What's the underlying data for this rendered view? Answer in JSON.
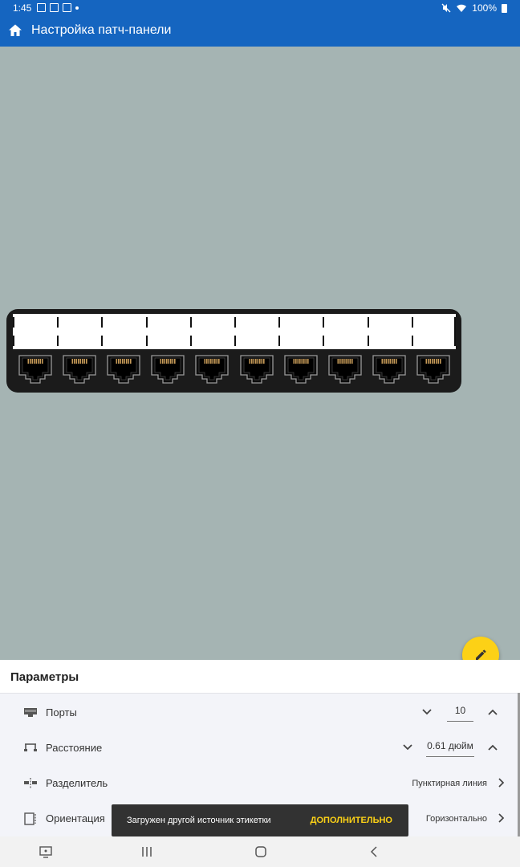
{
  "status_bar": {
    "time": "1:45",
    "battery": "100%",
    "icons": [
      "image-icon",
      "gmail-icon",
      "gallery-icon",
      "dot-icon",
      "mute-icon",
      "wifi-icon",
      "battery-icon"
    ]
  },
  "app_bar": {
    "title": "Настройка патч-панели",
    "icon": "home-icon"
  },
  "panel_preview": {
    "port_count": 10,
    "label_count": 10,
    "colors": {
      "panel": "#1b1b1b",
      "label": "#ffffff",
      "contacts": "#c69a58"
    }
  },
  "fab": {
    "icon": "pencil-icon",
    "color": "#fcd116"
  },
  "params": {
    "title": "Параметры",
    "ports": {
      "label": "Порты",
      "value": "10",
      "icon": "port-icon"
    },
    "spacing": {
      "label": "Расстояние",
      "value": "0.61 дюйм",
      "icon": "spacing-icon"
    },
    "divider": {
      "label": "Разделитель",
      "value": "Пунктирная линия",
      "icon": "divider-icon"
    },
    "orientation": {
      "label": "Ориентация",
      "value": "Горизонтально",
      "icon": "orientation-icon"
    }
  },
  "snackbar": {
    "message": "Загружен другой источник этикетки",
    "action": "ДОПОЛНИТЕЛЬНО"
  },
  "nav_bar": {
    "buttons": [
      "screenshot-icon",
      "recents-icon",
      "home-nav-icon",
      "back-icon"
    ]
  },
  "theme": {
    "primary": "#1565c0",
    "canvas": "#a5b4b3",
    "accent": "#fcd116"
  }
}
